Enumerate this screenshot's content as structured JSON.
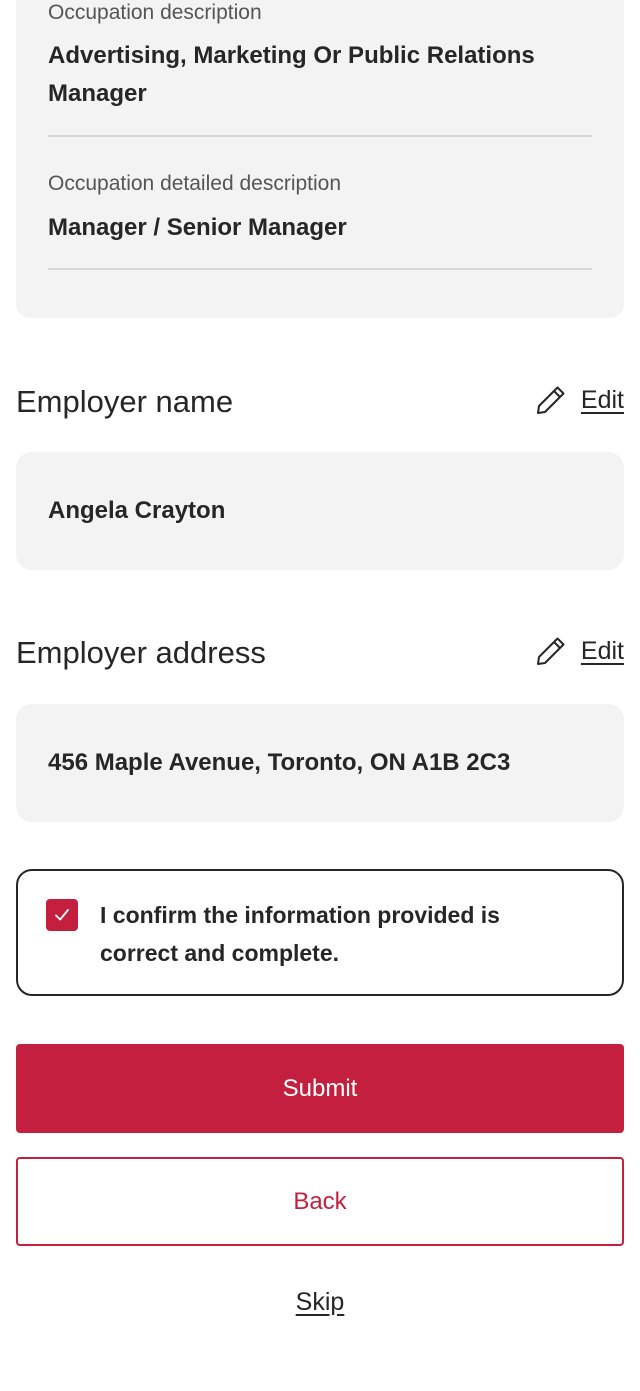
{
  "occupation": {
    "description_label": "Occupation description",
    "description_value": "Advertising, Marketing Or Public Relations Manager",
    "detailed_label": "Occupation detailed description",
    "detailed_value": "Manager / Senior Manager"
  },
  "employer_name": {
    "title": "Employer name",
    "edit_label": "Edit",
    "value": "Angela Crayton"
  },
  "employer_address": {
    "title": "Employer address",
    "edit_label": "Edit",
    "value": "456 Maple Avenue, Toronto, ON A1B 2C3"
  },
  "confirmation": {
    "checked": true,
    "text": "I confirm the information provided is correct and complete."
  },
  "actions": {
    "submit_label": "Submit",
    "back_label": "Back",
    "skip_label": "Skip"
  },
  "colors": {
    "brand_red": "#c41f3e",
    "card_bg": "#f3f3f3",
    "text": "#262626"
  },
  "icons": {
    "edit": "pencil-icon",
    "check": "checkmark-icon"
  }
}
